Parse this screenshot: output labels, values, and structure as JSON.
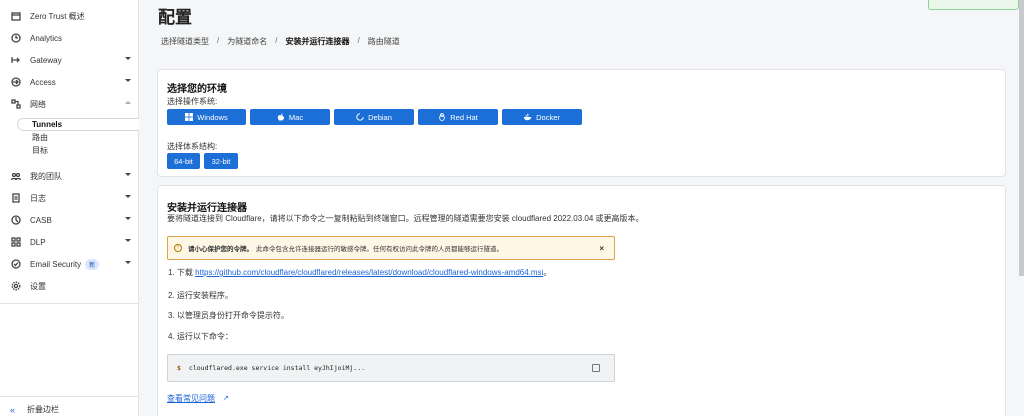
{
  "sidebar": {
    "items": [
      {
        "label": "Zero Trust 概述",
        "icon": "calendar-icon",
        "caret": false
      },
      {
        "label": "Analytics",
        "icon": "clock-icon",
        "caret": false
      },
      {
        "label": "Gateway",
        "icon": "arrow-right-icon",
        "caret": true
      },
      {
        "label": "Access",
        "icon": "login-icon",
        "caret": true
      },
      {
        "label": "网络",
        "icon": "network-icon",
        "caret": "up"
      }
    ],
    "network_subitems": [
      "Tunnels",
      "路由",
      "目标"
    ],
    "items2": [
      {
        "label": "我的团队",
        "icon": "team-icon",
        "caret": true
      },
      {
        "label": "日志",
        "icon": "log-icon",
        "caret": true
      },
      {
        "label": "CASB",
        "icon": "casb-icon",
        "caret": true
      },
      {
        "label": "DLP",
        "icon": "dlp-icon",
        "caret": true
      },
      {
        "label": "Email Security",
        "icon": "email-security-icon",
        "caret": true,
        "badge": "新"
      },
      {
        "label": "设置",
        "icon": "gear-icon",
        "caret": false
      }
    ],
    "collapse_label": "折叠边栏"
  },
  "page": {
    "title": "配置"
  },
  "breadcrumb": [
    "选择隧道类型",
    "为隧道命名",
    "安装并运行连接器",
    "路由隧道"
  ],
  "env_card": {
    "title": "选择您的环境",
    "os_label": "选择操作系统:",
    "os_buttons": [
      "Windows",
      "Mac",
      "Debian",
      "Red Hat",
      "Docker"
    ],
    "arch_label": "选择体系结构:",
    "arch_buttons": [
      "64-bit",
      "32-bit"
    ]
  },
  "install_card": {
    "title": "安装并运行连接器",
    "description": "要将隧道连接到 Cloudflare，请将以下命令之一复制粘贴到终端窗口。远程管理的隧道需要您安装 cloudflared 2022.03.04 或更高版本。",
    "warning_bold": "请小心保护您的令牌。",
    "warning_text": "此命令包含允许连接器运行的敏感令牌。任何有权访问此令牌的人员都能够运行隧道。",
    "warning_close": "×",
    "step1_prefix": "1. 下载",
    "step1_link": "https://github.com/cloudflare/cloudflared/releases/latest/download/cloudflared-windows-amd64.msi",
    "step1_suffix": "。",
    "step2": "2. 运行安装程序。",
    "step3": "3. 以管理员身份打开命令提示符。",
    "step4": "4. 运行以下命令：",
    "code_prompt": "$",
    "code": "cloudflared.exe service install eyJhIjoiMj...",
    "faq": "查看常见问题"
  }
}
